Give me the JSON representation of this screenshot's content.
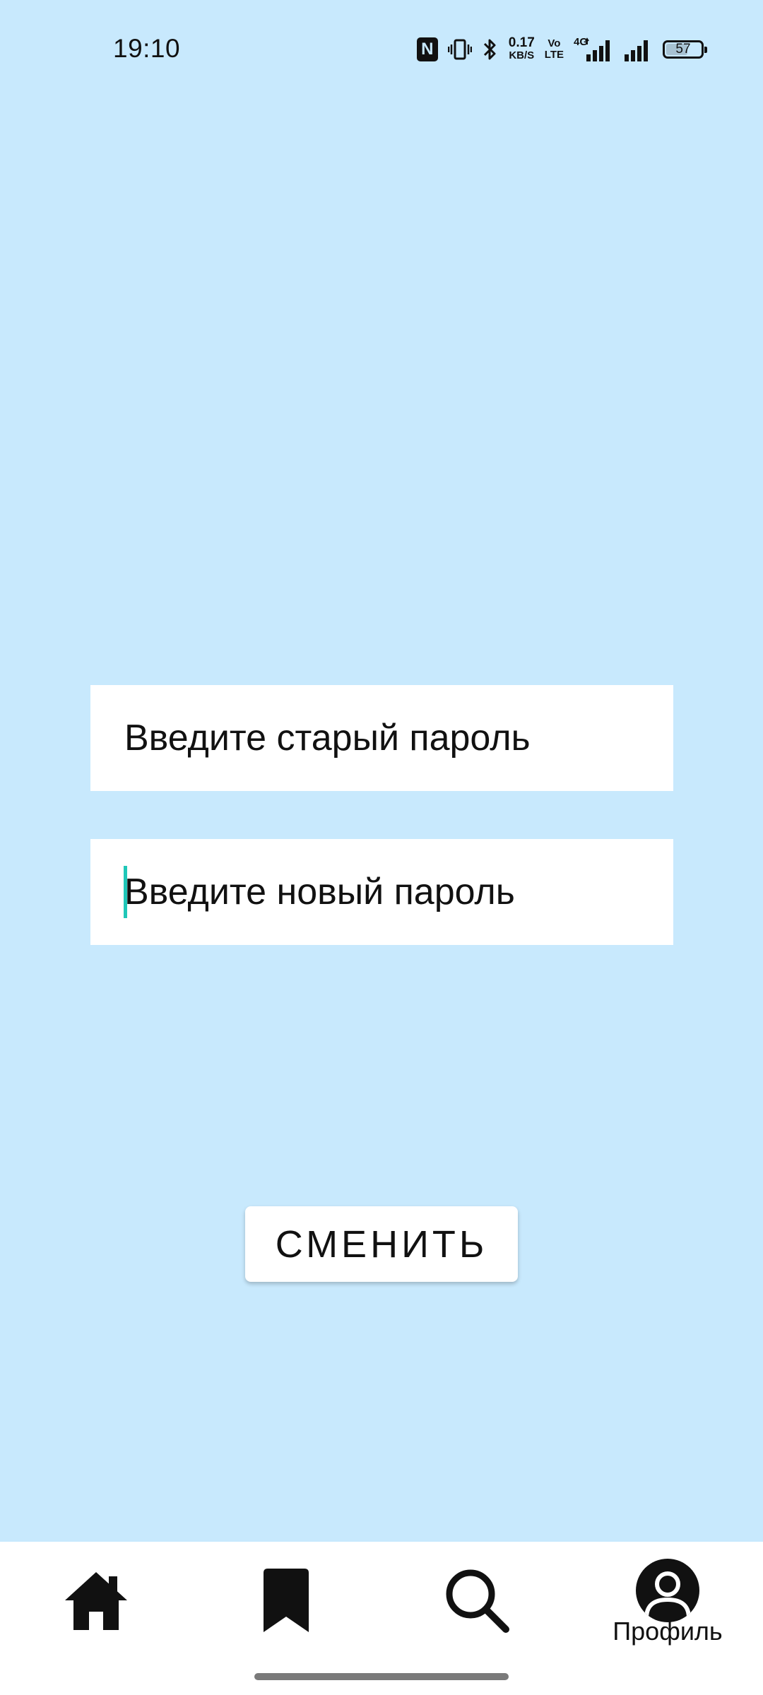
{
  "status_bar": {
    "time": "19:10",
    "nfc_label": "N",
    "speed_value": "0.17",
    "speed_unit": "KB/S",
    "volte_top": "Vo",
    "volte_bottom": "LTE",
    "network_type": "4G",
    "battery_level": "57",
    "icons": [
      "nfc-icon",
      "vibrate-icon",
      "bluetooth-icon",
      "signal-icon",
      "signal-icon",
      "battery-icon"
    ]
  },
  "form": {
    "old_password": {
      "value": "",
      "placeholder": "Введите старый пароль"
    },
    "new_password": {
      "value": "",
      "placeholder": "Введите новый пароль"
    },
    "submit_label": "СМЕНИТЬ"
  },
  "bottom_nav": {
    "items": [
      {
        "icon": "home-icon",
        "label": ""
      },
      {
        "icon": "bookmark-icon",
        "label": ""
      },
      {
        "icon": "search-icon",
        "label": ""
      },
      {
        "icon": "profile-icon",
        "label": "Профиль",
        "active": true
      }
    ]
  },
  "colors": {
    "background": "#c8e9fd",
    "surface": "#ffffff",
    "text": "#111111",
    "caret": "#1fc7b8"
  }
}
